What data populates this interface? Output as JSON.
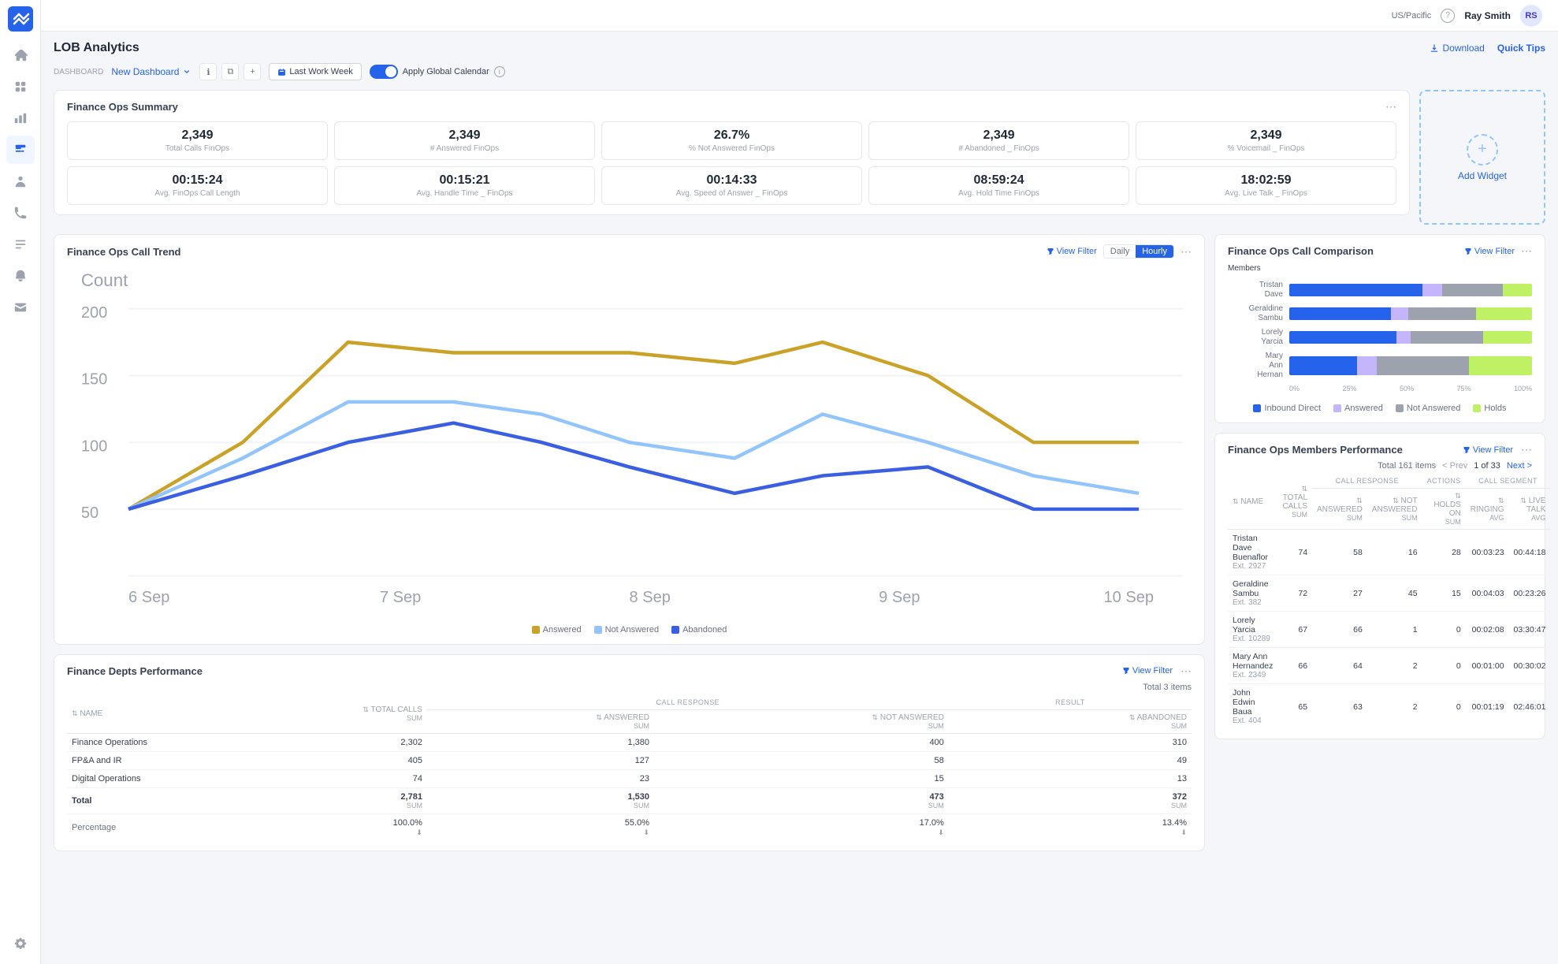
{
  "topbar": {
    "timezone": "US/Pacific",
    "user": "Ray Smith",
    "help": "?"
  },
  "page": {
    "title": "LOB Analytics",
    "download_label": "Download",
    "quick_tips_label": "Quick Tips"
  },
  "dashboard": {
    "section_label": "DASHBOARD",
    "name": "New Dashboard",
    "calendar_btn": "Last Work Week",
    "toggle_label": "Apply Global Calendar"
  },
  "summary": {
    "title": "Finance Ops Summary",
    "metrics": [
      {
        "value": "2,349",
        "label": "Total Calls FinOps"
      },
      {
        "value": "2,349",
        "label": "# Answered FinOps"
      },
      {
        "value": "26.7%",
        "label": "% Not Answered FinOps"
      },
      {
        "value": "2,349",
        "label": "# Abandoned _ FinOps"
      },
      {
        "value": "2,349",
        "label": "% Voicemail _ FinOps"
      }
    ],
    "metrics2": [
      {
        "value": "00:15:24",
        "label": "Avg. FinOps Call Length"
      },
      {
        "value": "00:15:21",
        "label": "Avg. Handle Time _ FinOps"
      },
      {
        "value": "00:14:33",
        "label": "Avg. Speed of Answer _ FinOps"
      },
      {
        "value": "08:59:24",
        "label": "Avg. Hold Time FinOps"
      },
      {
        "value": "18:02:59",
        "label": "Avg. Live Talk _ FinOps"
      }
    ],
    "add_widget_label": "Add Widget"
  },
  "call_trend": {
    "title": "Finance Ops Call Trend",
    "view_filter": "View Filter",
    "tab_daily": "Daily",
    "tab_hourly": "Hourly",
    "y_label": "Count",
    "x_labels": [
      "6 Sep",
      "7 Sep",
      "8 Sep",
      "9 Sep",
      "10 Sep"
    ],
    "y_values": [
      "200",
      "150",
      "100",
      "50"
    ],
    "legend": [
      {
        "color": "#c9a227",
        "label": "Answered"
      },
      {
        "color": "#93c5fd",
        "label": "Not Answered"
      },
      {
        "color": "#3b5fe2",
        "label": "Abandoned"
      }
    ]
  },
  "call_comparison": {
    "title": "Finance Ops Call Comparison",
    "view_filter": "View Filter",
    "members": [
      {
        "name": "Tristan\nDave",
        "inbound": 55,
        "answered": 8,
        "not_answered": 25,
        "holds": 12
      },
      {
        "name": "Geraldine\nSambu",
        "inbound": 42,
        "answered": 7,
        "not_answered": 28,
        "holds": 23
      },
      {
        "name": "Lorely\nYarcia",
        "inbound": 44,
        "answered": 6,
        "not_answered": 30,
        "holds": 20
      },
      {
        "name": "Mary\nAnn\nHernan",
        "inbound": 28,
        "answered": 8,
        "not_answered": 38,
        "holds": 26
      }
    ],
    "x_labels": [
      "0%",
      "25%",
      "50%",
      "75%",
      "100%"
    ],
    "legend": [
      {
        "color": "#2563eb",
        "label": "Inbound Direct"
      },
      {
        "color": "#c4b5fd",
        "label": "Answered"
      },
      {
        "color": "#9ca3af",
        "label": "Not Answered"
      },
      {
        "color": "#bef264",
        "label": "Holds"
      }
    ]
  },
  "dept_performance": {
    "title": "Finance Depts Performance",
    "view_filter": "View Filter",
    "total_items": "Total 3 items",
    "columns": {
      "name": "Name",
      "total_calls": "Total Calls",
      "call_response": "CALL RESPONSE",
      "answered": "Answered",
      "not_answered": "Not Answered",
      "result": "RESULT",
      "abandoned": "Abandoned"
    },
    "sub_labels": {
      "sum": "SUM"
    },
    "rows": [
      {
        "name": "Finance Operations",
        "total_calls": "2,302",
        "answered": "1,380",
        "not_answered": "400",
        "abandoned": "310"
      },
      {
        "name": "FP&A and IR",
        "total_calls": "405",
        "answered": "127",
        "not_answered": "58",
        "abandoned": "49"
      },
      {
        "name": "Digital Operations",
        "total_calls": "74",
        "answered": "23",
        "not_answered": "15",
        "abandoned": "13"
      }
    ],
    "total_row": {
      "label": "Total",
      "total_calls": "2,781",
      "answered": "1,530",
      "not_answered": "473",
      "abandoned": "372",
      "sub": "SUM"
    },
    "pct_row": {
      "label": "Percentage",
      "total_calls": "100.0%",
      "answered": "55.0%",
      "not_answered": "17.0%",
      "abandoned": "13.4%"
    }
  },
  "members_performance": {
    "title": "Finance Ops Members Performance",
    "view_filter": "View Filter",
    "total_items": "Total 161 items",
    "pagination": {
      "prev": "< Prev",
      "page": "1 of 33",
      "next": "Next >"
    },
    "columns": {
      "name": "Name",
      "total_calls": "Total Calls",
      "call_response": "CALL RESPONSE",
      "answered": "Answered",
      "not_answered": "Not Answered",
      "actions": "ACTIONS",
      "holds_on": "Holds On",
      "call_segment": "CALL SEGMENT",
      "ringing": "Ringing",
      "live_talk": "Live Talk"
    },
    "rows": [
      {
        "name": "Tristan Dave Buenaflor",
        "ext": "Ext. 2927",
        "total_calls": "74",
        "answered": "58",
        "not_answered": "16",
        "holds_on": "28",
        "ringing": "00:03:23",
        "live_talk": "00:44:18"
      },
      {
        "name": "Geraldine Sambu",
        "ext": "Ext. 382",
        "total_calls": "72",
        "answered": "27",
        "not_answered": "45",
        "holds_on": "15",
        "ringing": "00:04:03",
        "live_talk": "00:23:26"
      },
      {
        "name": "Lorely Yarcia",
        "ext": "Ext. 10289",
        "total_calls": "67",
        "answered": "66",
        "not_answered": "1",
        "holds_on": "0",
        "ringing": "00:02:08",
        "live_talk": "03:30:47"
      },
      {
        "name": "Mary Ann Hernandez",
        "ext": "Ext. 2349",
        "total_calls": "66",
        "answered": "64",
        "not_answered": "2",
        "holds_on": "0",
        "ringing": "00:01:00",
        "live_talk": "00:30:02"
      },
      {
        "name": "John Edwin Baua",
        "ext": "Ext. 404",
        "total_calls": "65",
        "answered": "63",
        "not_answered": "2",
        "holds_on": "0",
        "ringing": "00:01:19",
        "live_talk": "02:46:01"
      }
    ]
  },
  "sidebar": {
    "items": [
      {
        "id": "home",
        "icon": "home"
      },
      {
        "id": "dashboard",
        "icon": "grid"
      },
      {
        "id": "analytics",
        "icon": "bar-chart"
      },
      {
        "id": "reports",
        "icon": "line-chart",
        "active": true
      },
      {
        "id": "user",
        "icon": "user"
      },
      {
        "id": "phone",
        "icon": "phone"
      },
      {
        "id": "list",
        "icon": "list"
      },
      {
        "id": "bell",
        "icon": "bell"
      },
      {
        "id": "mail",
        "icon": "mail"
      },
      {
        "id": "settings",
        "icon": "settings"
      }
    ]
  }
}
